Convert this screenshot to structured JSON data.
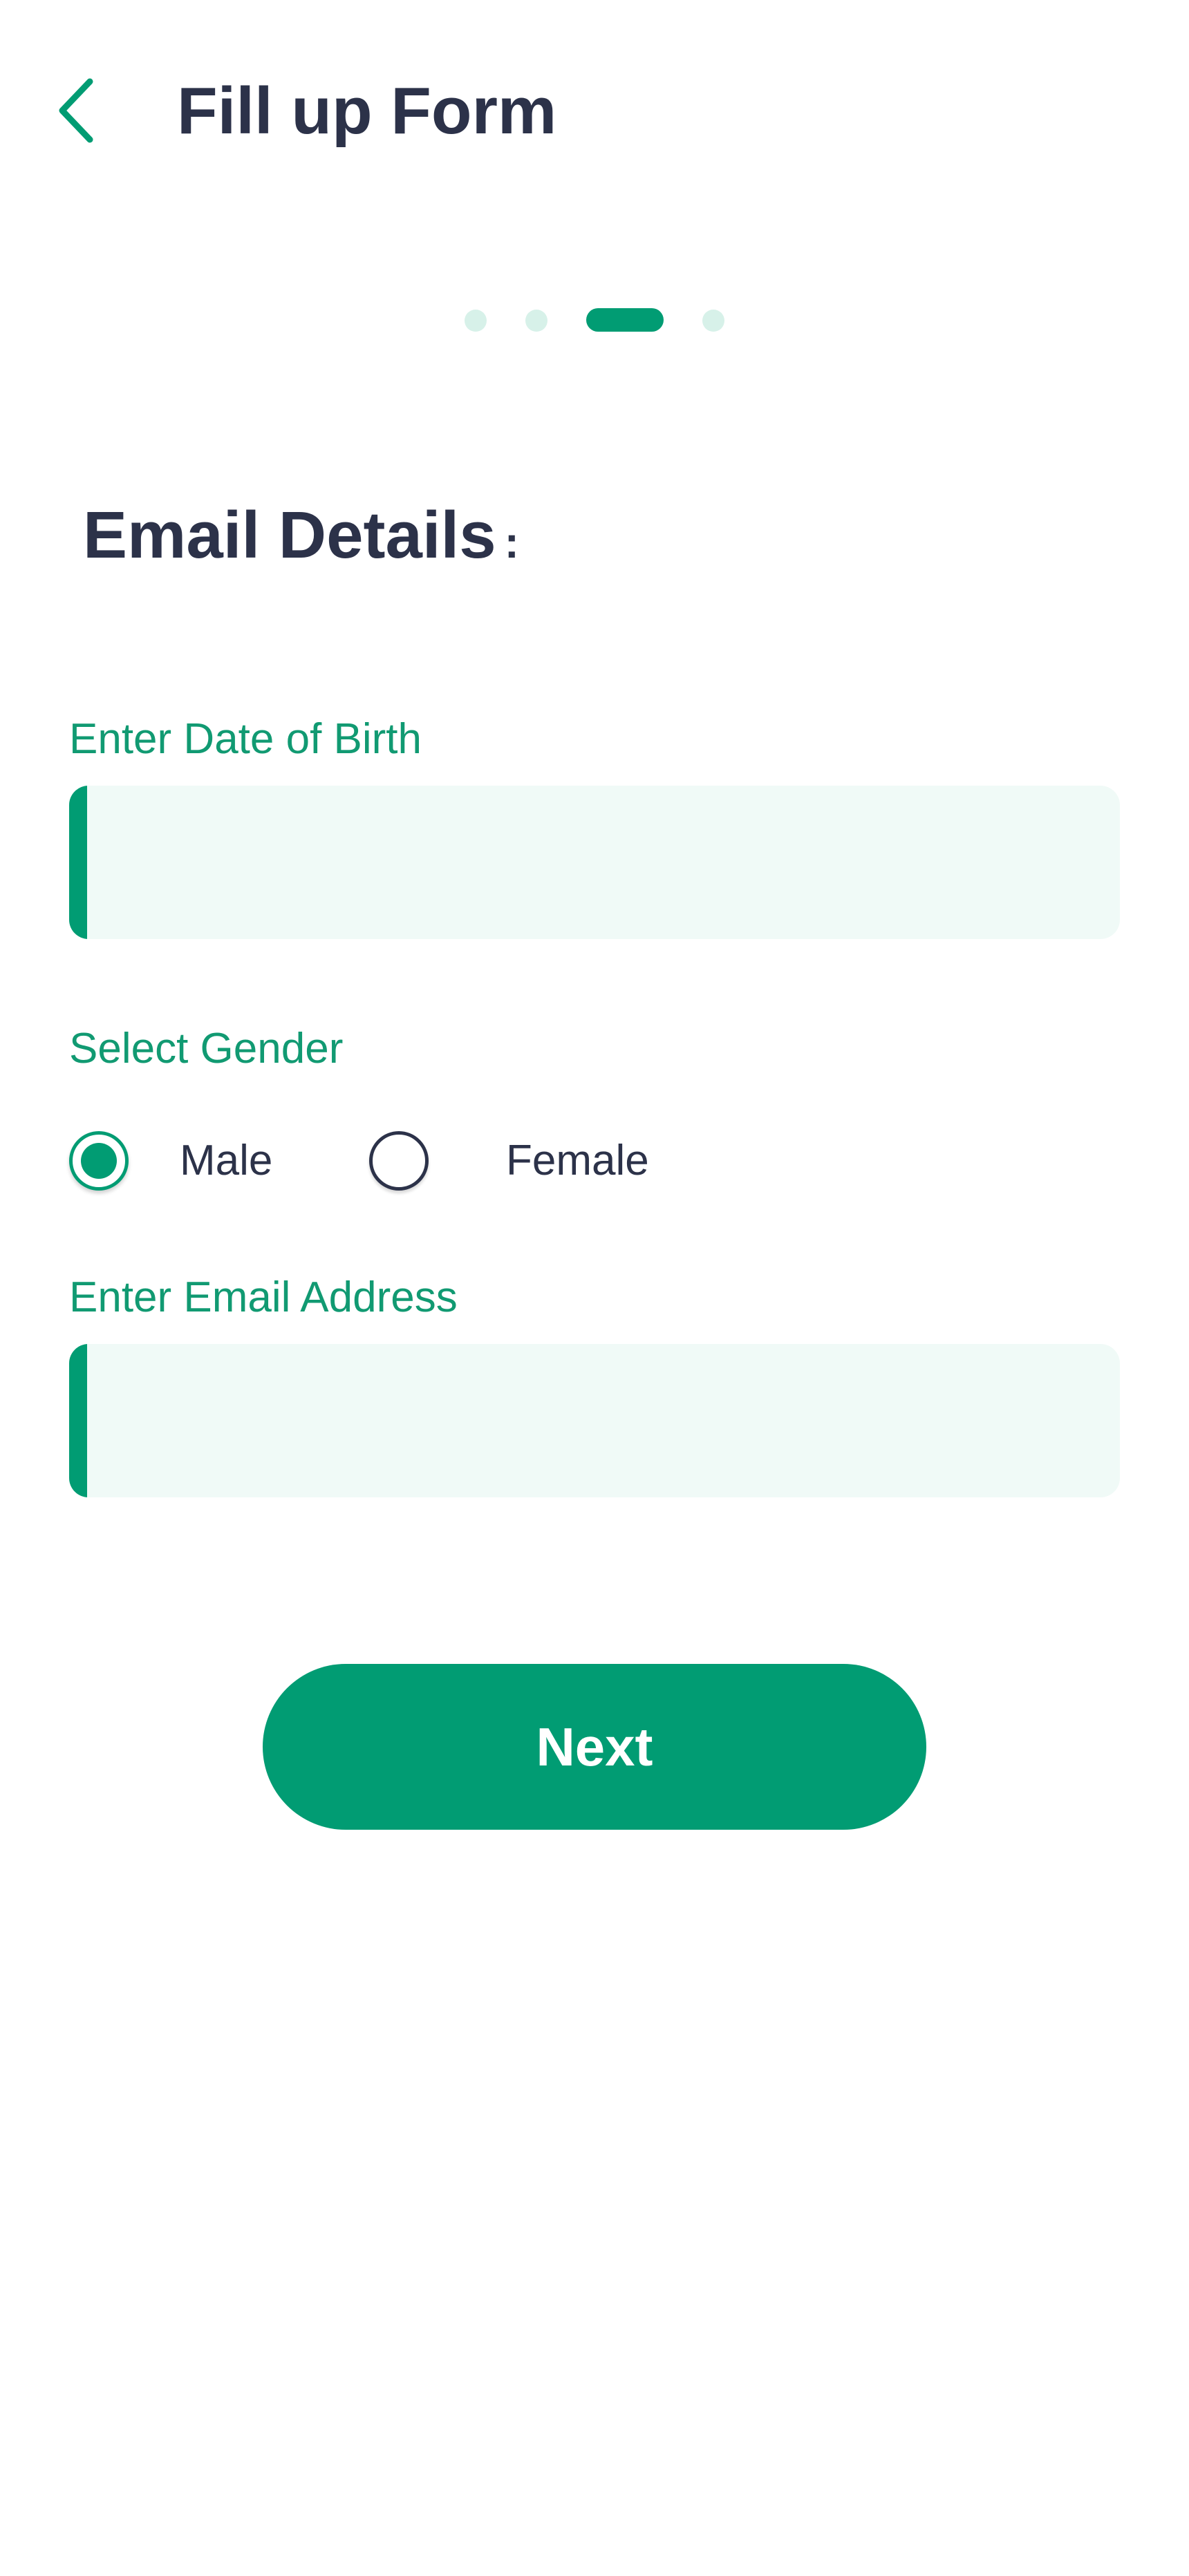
{
  "header": {
    "title": "Fill up Form",
    "back_icon": "chevron-left-icon"
  },
  "stepper": {
    "total_steps": 4,
    "current_step": 3
  },
  "section": {
    "title": "Email Details",
    "title_suffix": ":"
  },
  "form": {
    "dob": {
      "label": "Enter Date of Birth",
      "value": "",
      "placeholder": ""
    },
    "gender": {
      "label": "Select Gender",
      "options": [
        {
          "label": "Male",
          "selected": true
        },
        {
          "label": "Female",
          "selected": false
        }
      ]
    },
    "email": {
      "label": "Enter Email Address",
      "value": "",
      "placeholder": ""
    }
  },
  "actions": {
    "next_label": "Next"
  },
  "colors": {
    "primary": "#019c73",
    "label": "#119a72",
    "text_dark": "#2c3249",
    "input_bg": "#f0faf7",
    "dot_inactive": "#d7f1e9"
  }
}
